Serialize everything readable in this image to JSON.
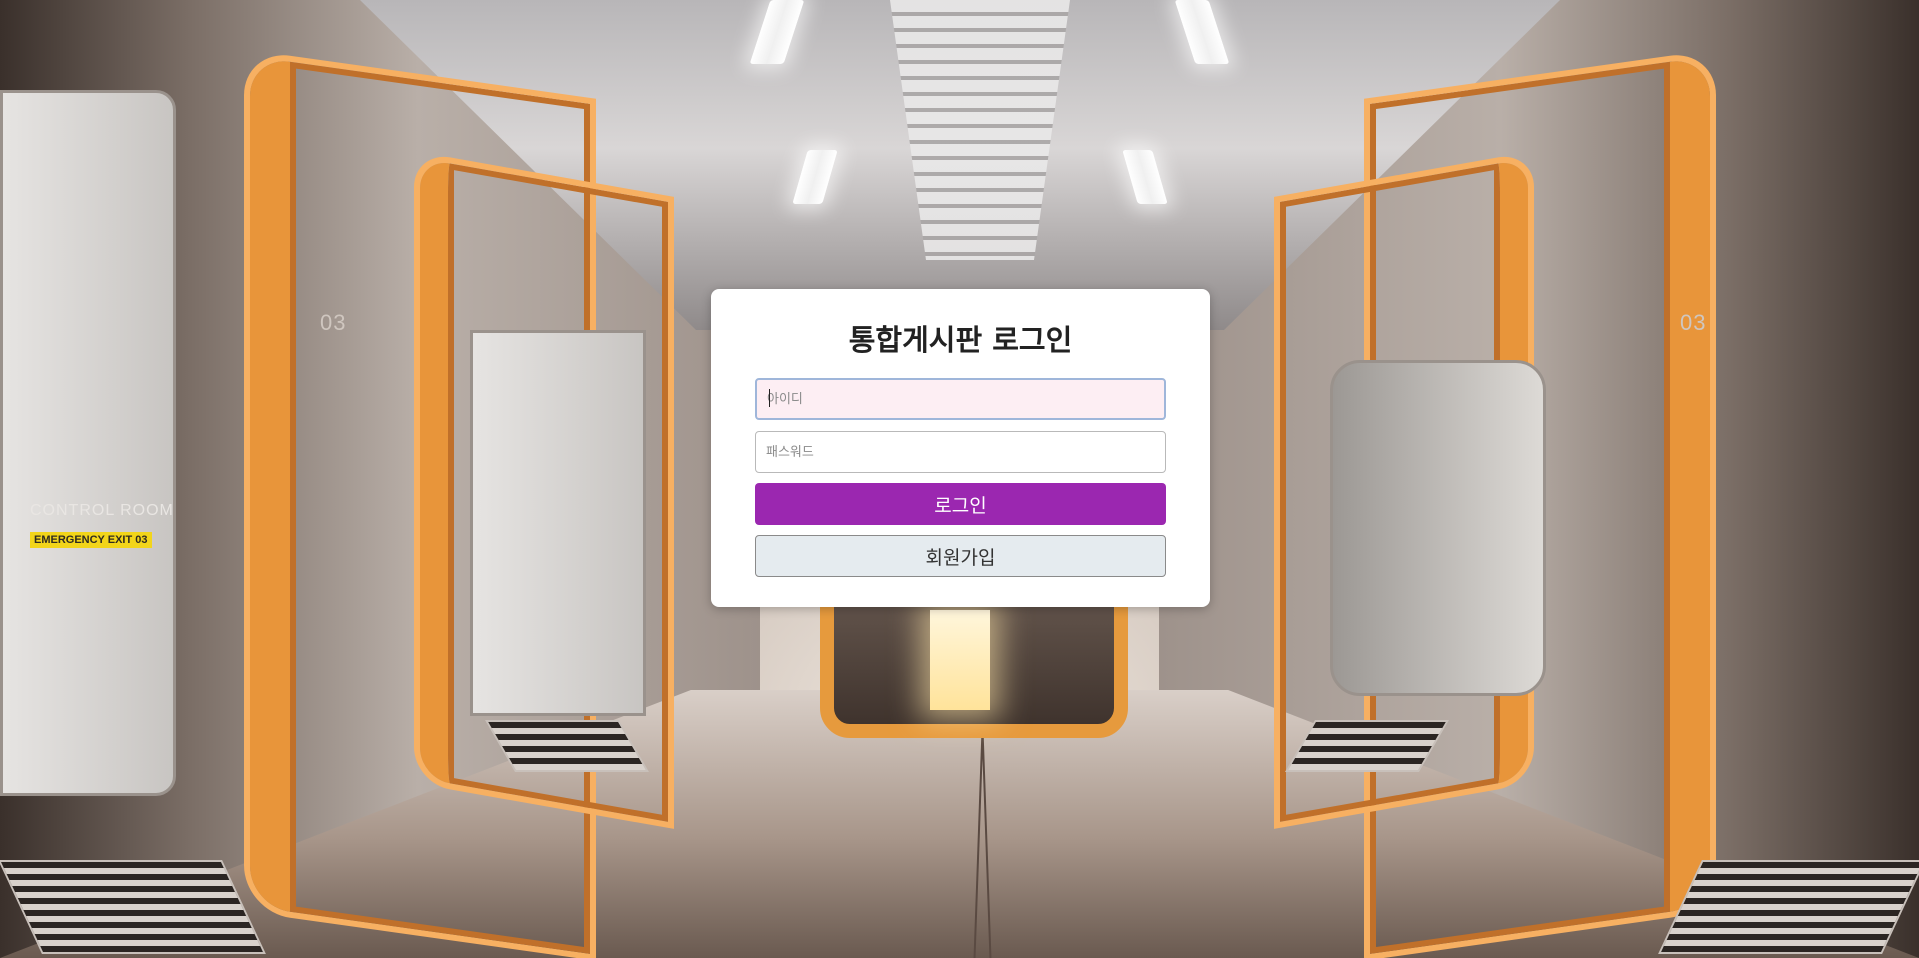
{
  "background": {
    "signs": {
      "control_room": "CONTROL ROOM",
      "emergency_exit": "EMERGENCY EXIT 03",
      "sector_left": "03",
      "sector_right": "03"
    }
  },
  "login": {
    "title": "통합게시판 로그인",
    "id_placeholder": "아이디",
    "id_value": "",
    "password_placeholder": "패스워드",
    "password_value": "",
    "login_label": "로그인",
    "signup_label": "회원가입",
    "colors": {
      "login_button": "#9b27b0",
      "signup_button": "#e5ebef",
      "id_field_bg": "#fdeef3"
    }
  }
}
